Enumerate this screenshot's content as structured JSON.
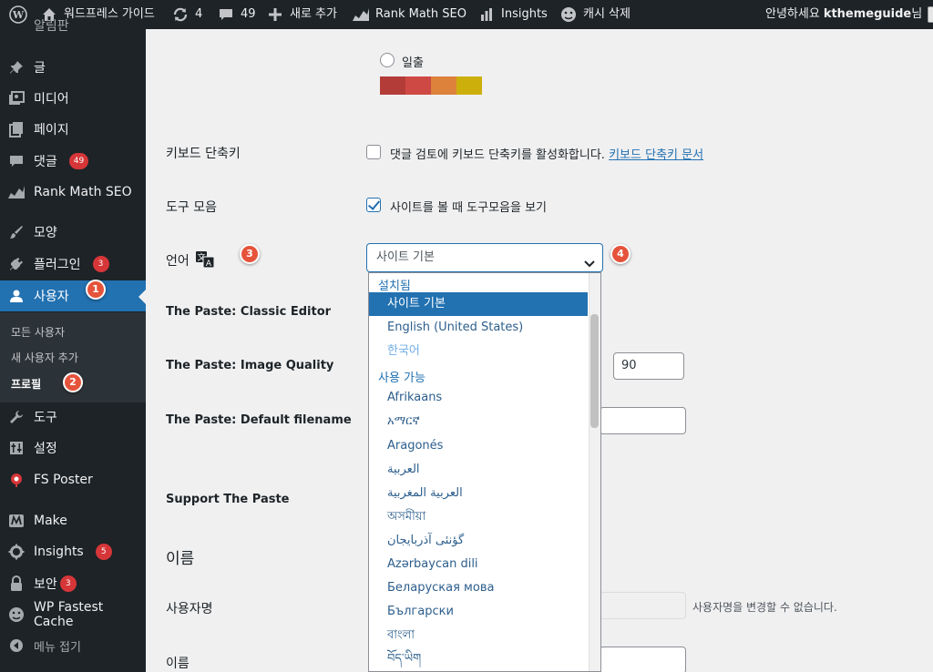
{
  "adminbar": {
    "site_name": "워드프레스 가이드",
    "updates_count": "4",
    "comments_count": "49",
    "new_label": "새로 추가",
    "rankmath_label": "Rank Math SEO",
    "insights_label": "Insights",
    "cache_label": "캐시 삭제",
    "greeting": "안녕하세요",
    "username": "kthemeguide",
    "suffix": "님"
  },
  "sidebar": {
    "top_partial": "알림판",
    "items": [
      {
        "label": "글"
      },
      {
        "label": "미디어"
      },
      {
        "label": "페이지"
      },
      {
        "label": "댓글",
        "badge": "49"
      },
      {
        "label": "Rank Math SEO"
      },
      {
        "label": "모양"
      },
      {
        "label": "플러그인",
        "badge": "3"
      },
      {
        "label": "사용자"
      },
      {
        "label": "도구"
      },
      {
        "label": "설정"
      },
      {
        "label": "FS Poster"
      },
      {
        "label": "Make"
      },
      {
        "label": "Insights",
        "badge": "5"
      },
      {
        "label": "보안",
        "badge": "3"
      },
      {
        "label": "WP Fastest Cache"
      },
      {
        "label": "메뉴 접기"
      }
    ],
    "submenu": [
      {
        "label": "모든 사용자"
      },
      {
        "label": "새 사용자 추가"
      },
      {
        "label": "프로필"
      }
    ]
  },
  "steps": [
    "1",
    "2",
    "3",
    "4"
  ],
  "main": {
    "color_scheme_label": "일출",
    "swatches": [
      "#b43c38",
      "#cf4944",
      "#dd823b",
      "#ccaf0b"
    ],
    "keyboard_label": "키보드 단축키",
    "keyboard_text": "댓글 검토에 키보드 단축키를 활성화합니다.",
    "keyboard_link": "키보드 단축키 문서",
    "toolbar_label": "도구 모음",
    "toolbar_text": "사이트를 볼 때 도구모음을 보기",
    "language_label": "언어",
    "language_value": "사이트 기본",
    "paste_classic_label": "The Paste: Classic Editor",
    "paste_quality_label": "The Paste: Image Quality",
    "paste_quality_value": "90",
    "paste_filename_label": "The Paste: Default filename",
    "support_label": "Support The Paste",
    "name_section": "이름",
    "username_label": "사용자명",
    "username_hint": "사용자명을 변경할 수 없습니다.",
    "firstname_label": "이름"
  },
  "dropdown": {
    "installed_group": "설치됨",
    "installed": [
      {
        "label": "사이트 기본",
        "selected": true
      },
      {
        "label": "English (United States)"
      },
      {
        "label": "한국어",
        "muted": true
      }
    ],
    "available_group": "사용 가능",
    "available": [
      {
        "label": "Afrikaans"
      },
      {
        "label": "አማርኛ"
      },
      {
        "label": "Aragonés"
      },
      {
        "label": "العربية"
      },
      {
        "label": "العربية المغربية"
      },
      {
        "label": "অসমীয়া"
      },
      {
        "label": "گؤنئی آذربایجان"
      },
      {
        "label": "Azərbaycan dili"
      },
      {
        "label": "Беларуская мова"
      },
      {
        "label": "Български"
      },
      {
        "label": "বাংলা"
      },
      {
        "label": "བོད་ཡིག"
      }
    ]
  }
}
